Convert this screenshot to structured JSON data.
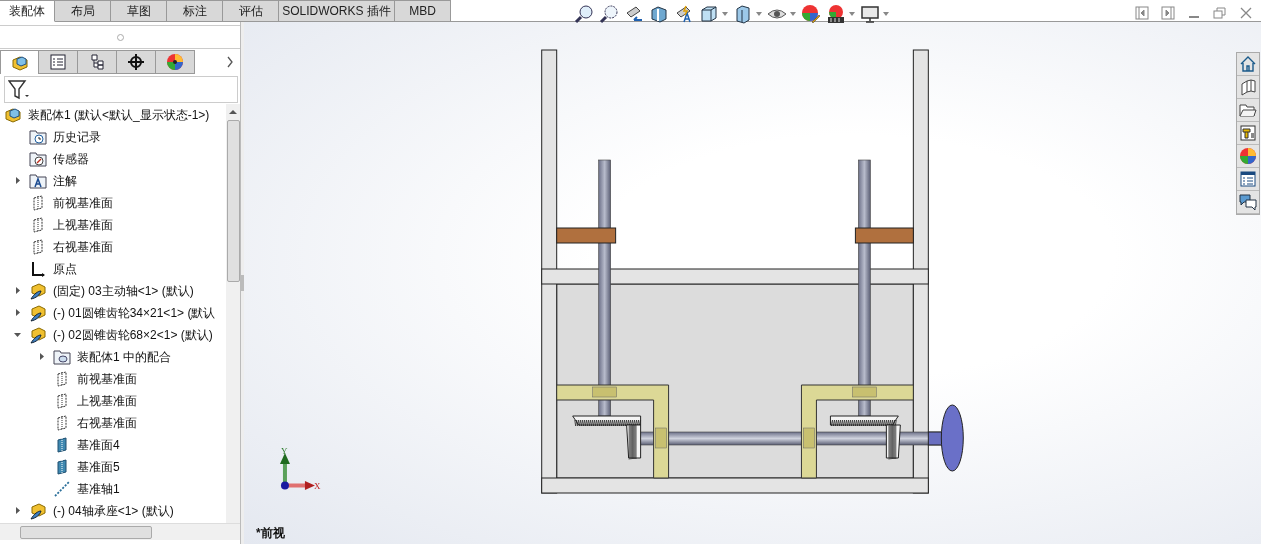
{
  "tabs": [
    {
      "label": "装配体",
      "selected": true
    },
    {
      "label": "布局",
      "selected": false
    },
    {
      "label": "草图",
      "selected": false
    },
    {
      "label": "标注",
      "selected": false
    },
    {
      "label": "评估",
      "selected": false
    },
    {
      "label": "SOLIDWORKS 插件",
      "selected": false
    },
    {
      "label": "MBD",
      "selected": false
    }
  ],
  "panel_tabs": [
    {
      "kind": "feature",
      "selected": true
    },
    {
      "kind": "property",
      "selected": false
    },
    {
      "kind": "config",
      "selected": false
    },
    {
      "kind": "target",
      "selected": false
    },
    {
      "kind": "display",
      "selected": false
    }
  ],
  "tree": [
    {
      "kind": "assembly",
      "label": "装配体1  (默认<默认_显示状态-1>)",
      "children": [
        {
          "kind": "history",
          "label": "历史记录"
        },
        {
          "kind": "sensor",
          "label": "传感器"
        },
        {
          "kind": "annotation",
          "label": "注解",
          "expanded": false
        },
        {
          "kind": "plane",
          "label": "前视基准面"
        },
        {
          "kind": "plane",
          "label": "上视基准面"
        },
        {
          "kind": "plane",
          "label": "右视基准面"
        },
        {
          "kind": "origin",
          "label": "原点"
        },
        {
          "kind": "part",
          "label": "(固定) 03主动轴<1> (默认)",
          "expanded": false
        },
        {
          "kind": "part",
          "label": "(-) 01圆锥齿轮34×21<1> (默认",
          "expanded": false
        },
        {
          "kind": "part",
          "label": "(-) 02圆锥齿轮68×2<1> (默认)",
          "expanded": true,
          "children": [
            {
              "kind": "mates",
              "label": "装配体1 中的配合",
              "expanded": false
            },
            {
              "kind": "plane",
              "label": "前视基准面"
            },
            {
              "kind": "plane",
              "label": "上视基准面"
            },
            {
              "kind": "plane",
              "label": "右视基准面"
            },
            {
              "kind": "plane-solid",
              "label": "基准面4"
            },
            {
              "kind": "plane-solid",
              "label": "基准面5"
            },
            {
              "kind": "axis",
              "label": "基准轴1"
            }
          ]
        },
        {
          "kind": "part",
          "label": "(-) 04轴承座<1> (默认)",
          "expanded": false
        }
      ]
    }
  ],
  "triad": {
    "x": "X",
    "y": "Y"
  },
  "view_label": "*前视"
}
